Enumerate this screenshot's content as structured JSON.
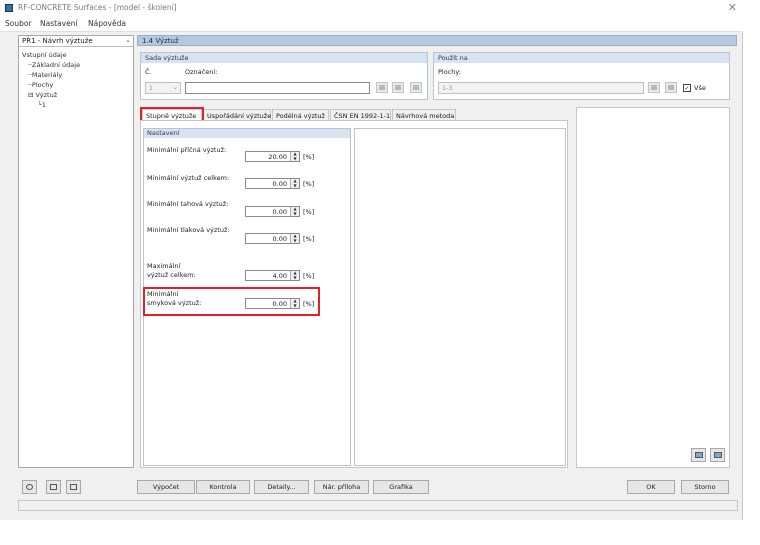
{
  "window": {
    "title": "RF-CONCRETE Surfaces - [model - školení]"
  },
  "menu": {
    "items": [
      "Soubor",
      "Nastavení",
      "Nápověda"
    ]
  },
  "left": {
    "case_select": "PŘ1 - Návrh výztuže",
    "tree": {
      "root": "Vstupní údaje",
      "items": [
        "Základní údaje",
        "Materiály",
        "Plochy"
      ],
      "vyztuz": "Výztuž",
      "vyztuz_child": "1"
    }
  },
  "main": {
    "header": "1.4 Výztuž",
    "sada": {
      "title": "Sada výztuže",
      "c_label": "Č.",
      "c_value": "1",
      "oznaceni_label": "Označení:",
      "oznaceni_value": ""
    },
    "pouzit": {
      "title": "Použít na",
      "plochy_label": "Plochy:",
      "plochy_value": "1-3",
      "vse_label": "Vše",
      "vse_checked": true
    },
    "tabs": [
      "Stupně výztuže",
      "Uspořádání výztuže",
      "Podélná výztuž",
      "ČSN EN 1992-1-1",
      "Návrhová metoda"
    ],
    "active_tab": 0,
    "nastaveni": {
      "title": "Nastavení",
      "rows": [
        {
          "label": "Minimální příčná výztuž:",
          "value": "20.00",
          "unit": "[%]"
        },
        {
          "label": "Minimální výztuž celkem:",
          "value": "0.00",
          "unit": "[%]"
        },
        {
          "label": "Minimální tahová výztuž:",
          "value": "0.00",
          "unit": "[%]"
        },
        {
          "label": "Minimální tlaková výztuž:",
          "value": "0.00",
          "unit": "[%]"
        },
        {
          "label1": "Maximální",
          "label2": "výztuž celkem:",
          "value": "4.00",
          "unit": "[%]"
        },
        {
          "label1": "Minimální",
          "label2": "smyková výztuž:",
          "value": "0.00",
          "unit": "[%]"
        }
      ]
    }
  },
  "buttons": {
    "vypocet": "Výpočet",
    "kontrola": "Kontrola",
    "detaily": "Detaily...",
    "nar_priloha": "Nár. příloha",
    "grafika": "Grafika",
    "ok": "OK",
    "storno": "Storno"
  },
  "icons": {
    "help": "help-icon",
    "prev": "previous-icon",
    "next": "next-icon",
    "new": "new-icon",
    "copy": "copy-icon",
    "delete": "delete-icon",
    "select": "select-surfaces-icon",
    "clear": "clear-icon"
  }
}
